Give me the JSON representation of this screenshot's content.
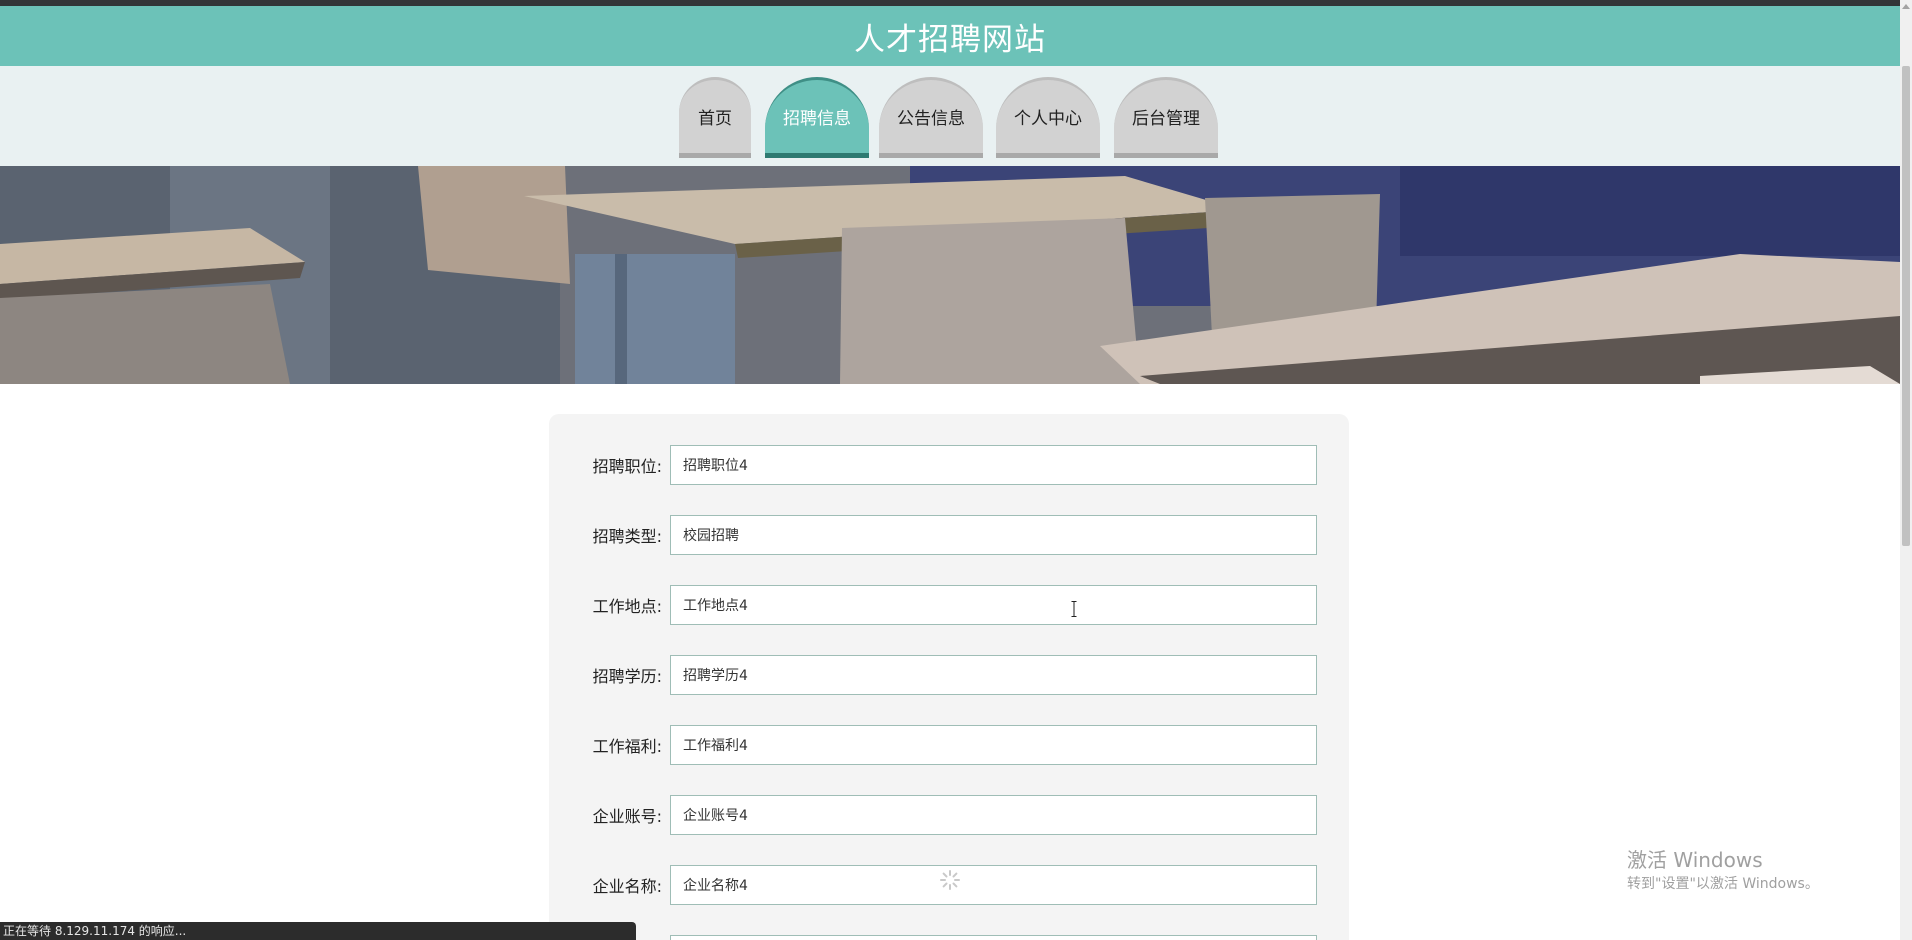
{
  "site": {
    "title": "人才招聘网站"
  },
  "nav": {
    "tabs": [
      {
        "label": "首页",
        "active": false
      },
      {
        "label": "招聘信息",
        "active": true
      },
      {
        "label": "公告信息",
        "active": false
      },
      {
        "label": "个人中心",
        "active": false
      },
      {
        "label": "后台管理",
        "active": false
      }
    ]
  },
  "form": {
    "fields": [
      {
        "label": "招聘职位:",
        "value": "招聘职位4"
      },
      {
        "label": "招聘类型:",
        "value": "校园招聘"
      },
      {
        "label": "工作地点:",
        "value": "工作地点4"
      },
      {
        "label": "招聘学历:",
        "value": "招聘学历4"
      },
      {
        "label": "工作福利:",
        "value": "工作福利4"
      },
      {
        "label": "企业账号:",
        "value": "企业账号4"
      },
      {
        "label": "企业名称:",
        "value": "企业名称4"
      },
      {
        "label": "",
        "value": ""
      }
    ]
  },
  "watermark": {
    "title": "激活 Windows",
    "subtitle": "转到\"设置\"以激活 Windows。"
  },
  "status": {
    "text": "正在等待 8.129.11.174 的响应..."
  },
  "colors": {
    "header": "#6cc2b8",
    "nav_background": "#e9f1f2",
    "tab_inactive": "#d2d2d2",
    "tab_active": "#6cc2b8",
    "form_panel": "#f4f4f4",
    "input_border": "#9fbdb6"
  }
}
